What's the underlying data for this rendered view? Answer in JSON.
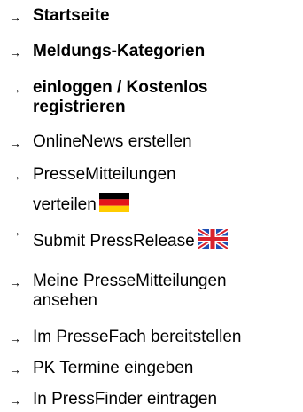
{
  "menu": {
    "arrow_glyph": "→",
    "items": [
      {
        "label": "Startseite"
      },
      {
        "label": "Meldungs-Kategorien"
      },
      {
        "line1": "einloggen / Kostenlos",
        "line2": "registrieren"
      },
      {
        "label": "OnlineNews erstellen"
      },
      {
        "line1": "PresseMitteilungen",
        "line2": "verteilen",
        "flag_icon": "german-flag-icon"
      },
      {
        "label": "Submit PressRelease",
        "flag_icon": "uk-flag-icon"
      },
      {
        "line1": "Meine PresseMitteilungen",
        "line2": "ansehen"
      },
      {
        "label": "Im PresseFach bereitstellen"
      },
      {
        "label": "PK Termine eingeben"
      },
      {
        "label": "In PressFinder eintragen"
      }
    ]
  }
}
